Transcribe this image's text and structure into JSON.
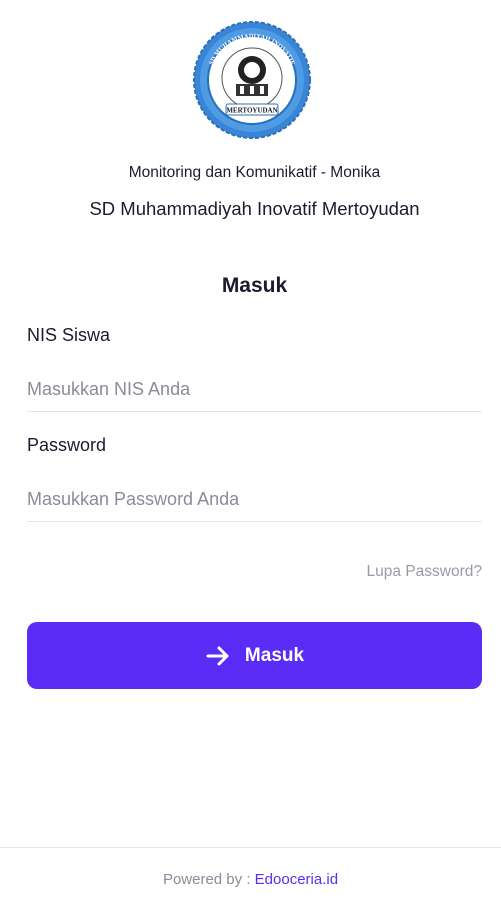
{
  "header": {
    "logo_text_top": "SD MUHAMMADIYAH INOVATIF",
    "logo_text_bottom": "MERTOYUDAN",
    "app_subtitle": "Monitoring dan Komunikatif - Monika",
    "school_name": "SD Muhammadiyah Inovatif Mertoyudan"
  },
  "form": {
    "title": "Masuk",
    "nis": {
      "label": "NIS Siswa",
      "value": "",
      "placeholder": "Masukkan NIS Anda"
    },
    "password": {
      "label": "Password",
      "value": "",
      "placeholder": "Masukkan Password Anda"
    },
    "forgot_label": "Lupa Password?",
    "submit_label": "Masuk"
  },
  "footer": {
    "powered_by": "Powered by : ",
    "brand": "Edooceria.id"
  },
  "colors": {
    "accent": "#5b2cf5",
    "logo_blue": "#3a86d6",
    "placeholder": "#8b8b99",
    "muted_link": "#9a9aa6"
  },
  "icons": {
    "logo": "school-seal-icon",
    "submit": "arrow-right-icon"
  }
}
